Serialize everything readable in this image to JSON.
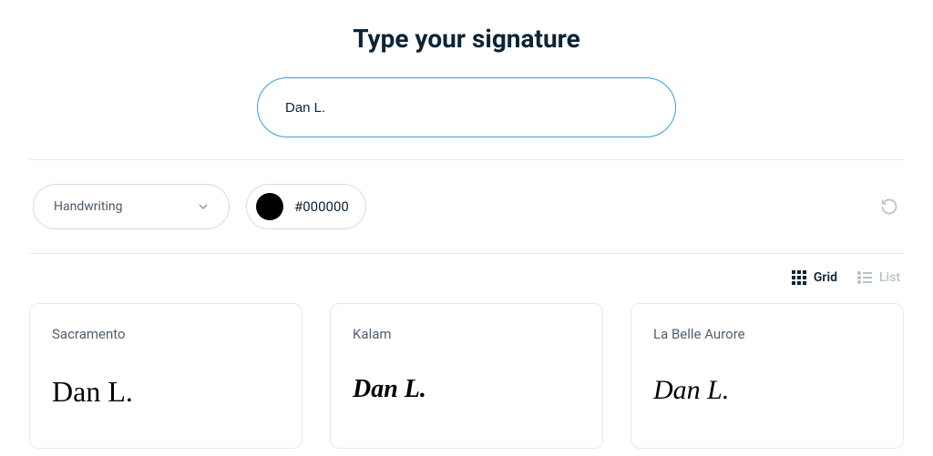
{
  "title": "Type your signature",
  "input": {
    "value": "Dan L.",
    "placeholder": ""
  },
  "toolbar": {
    "style_label": "Handwriting",
    "color_hex": "#000000",
    "color_swatch": "#000000"
  },
  "view": {
    "grid_label": "Grid",
    "list_label": "List",
    "active": "grid"
  },
  "fonts": [
    {
      "name": "Sacramento",
      "preview": "Dan L.",
      "class": "f-sacramento"
    },
    {
      "name": "Kalam",
      "preview": "Dan L.",
      "class": "f-kalam"
    },
    {
      "name": "La Belle Aurore",
      "preview": "Dan L.",
      "class": "f-labelle"
    }
  ]
}
